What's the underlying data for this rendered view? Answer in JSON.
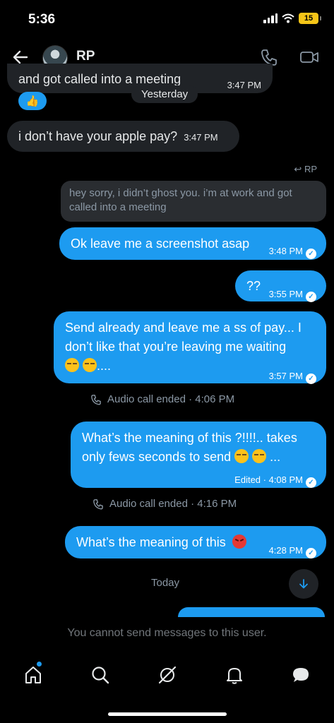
{
  "status_bar": {
    "time": "5:36",
    "battery": "15"
  },
  "header": {
    "name": "RP"
  },
  "messages": {
    "m1": {
      "text": "and got called into a meeting",
      "time": "3:47 PM",
      "reaction": "👍"
    },
    "yesterday_label": "Yesterday",
    "m2": {
      "text": "i don’t have your apple pay?",
      "time": "3:47 PM"
    },
    "reply_to": "RP",
    "quoted_text": "hey sorry, i didn’t ghost you. i’m at work and got called into a meeting",
    "m3": {
      "text": "Ok leave me a screenshot asap",
      "time": "3:48 PM"
    },
    "m4": {
      "text": "??",
      "time": "3:55 PM"
    },
    "m5": {
      "line1": "Send already and leave me a ss of pay... I",
      "line2": "don’t like that you’re leaving me waiting",
      "suffix": "....",
      "time": "3:57 PM"
    },
    "call1": "Audio call ended · 4:06 PM",
    "m6": {
      "line1": "What’s the meaning of this ?!!!!.. takes",
      "line2": "only fews seconds to send",
      "suffix": "...",
      "time": "Edited · 4:08 PM"
    },
    "call2": "Audio call ended · 4:16 PM",
    "m7": {
      "text": "What’s the meaning of this",
      "time": "4:28 PM"
    },
    "today_label": "Today"
  },
  "footer_note": "You cannot send messages to this user.",
  "icons": [
    "back-arrow-icon",
    "phone-icon",
    "video-icon",
    "home-icon",
    "search-icon",
    "grok-icon",
    "bell-icon",
    "messages-icon"
  ],
  "colors": {
    "accent": "#1d9bf0",
    "received_bubble": "#202327",
    "background": "#000000"
  }
}
